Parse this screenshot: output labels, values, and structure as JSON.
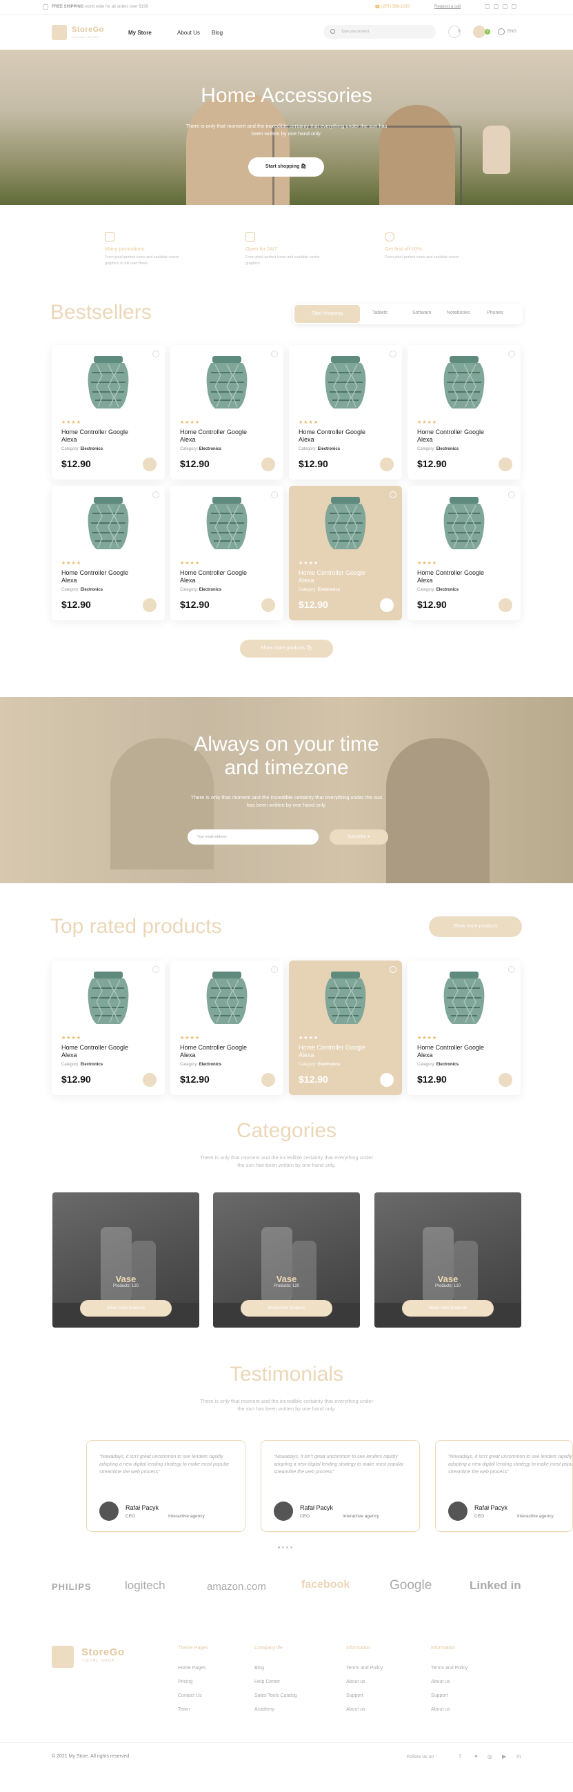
{
  "topbar": {
    "free_shipping_bold": "FREE SHIPPING",
    "free_shipping_text": "world wide for all orders over $199",
    "phone": "(207) 388-1220",
    "request_call": "Request a call"
  },
  "header": {
    "logo": {
      "name": "StoreGo",
      "tagline": "LOCAL SHOP"
    },
    "nav": [
      "My Store",
      "About Us",
      "Blog"
    ],
    "search_placeholder": "Type your product",
    "wishlist_count": "0",
    "cart_count": "0",
    "language": "ENG"
  },
  "hero": {
    "title": "Home Accessories",
    "text": "There is only that moment and the incredible certainty that everything under the sun has been written by one hand only.",
    "button": "Start shopping"
  },
  "features": [
    {
      "title": "Many promotions",
      "text": "From pixel-perfect icons and scalable vector graphics to full user flows"
    },
    {
      "title": "Open for 24/7",
      "text": "From pixel-perfect icons and scalable vector graphics"
    },
    {
      "title": "Get first off 10%",
      "text": "From pixel-perfect icons and scalable vector"
    }
  ],
  "bestsellers": {
    "title": "Bestsellers",
    "tabs": [
      "Start shopping",
      "Tablets",
      "Software",
      "Notebooks",
      "Phones"
    ],
    "show_more": "Show more products"
  },
  "product": {
    "stars": "★★★★",
    "name": "Home Controller Google Alexa",
    "category_label": "Category:",
    "category": "Electronics",
    "price": "$12.90"
  },
  "timezone": {
    "title_line1": "Always on your time",
    "title_line2": "and timezone",
    "text": "There is only that moment and the incredible certainty that everything under the sun has been written by one hand only.",
    "email_placeholder": "Your email address",
    "subscribe": "Subscribe"
  },
  "top_rated": {
    "title": "Top rated products",
    "show_more": "Show more products"
  },
  "categories": {
    "title": "Categories",
    "text": "There is only that moment and the incredible certainty that everything under the sun has been written by one hand only.",
    "items": [
      {
        "name": "Vase",
        "count": "Products: 120",
        "button": "Show more products"
      },
      {
        "name": "Vase",
        "count": "Products: 120",
        "button": "Show more products"
      },
      {
        "name": "Vase",
        "count": "Products: 120",
        "button": "Show more products"
      }
    ]
  },
  "testimonials": {
    "title": "Testimonials",
    "text": "There is only that moment and the incredible certainty that everything under the sun has been written by one hand only.",
    "items": [
      {
        "quote": "“Nowadays, it isn’t great uncommon to see lenders rapidly adopting a new digital lending strategy to make most popular streamline the web process”",
        "name": "Rafał Pacyk",
        "role": "CEO",
        "company": "Interactive agency"
      },
      {
        "quote": "“Nowadays, it isn’t great uncommon to see lenders rapidly adopting a new digital lending strategy to make most popular streamline the web process”",
        "name": "Rafał Pacyk",
        "role": "CEO",
        "company": "Interactive agency"
      },
      {
        "quote": "“Nowadays, it isn’t great uncommon to see lenders rapidly adopting a new digital lending strategy to make most popular streamline the web process”",
        "name": "Rafał Pacyk",
        "role": "CEO",
        "company": "Interactive agency"
      }
    ]
  },
  "brands": [
    "PHILIPS",
    "logitech",
    "amazon.com",
    "facebook",
    "Google",
    "Linked in"
  ],
  "footer": {
    "logo": {
      "name": "StoreGo",
      "tagline": "LOCAL SHOP"
    },
    "columns": [
      {
        "title": "Theme Pages",
        "links": [
          "Home Pages",
          "Pricing",
          "Contact Us",
          "Team"
        ]
      },
      {
        "title": "Company life",
        "links": [
          "Blog",
          "Help Center",
          "Sales Tools Catalog",
          "Academy"
        ]
      },
      {
        "title": "Information",
        "links": [
          "Terms and Policy",
          "About us",
          "Support",
          "About us"
        ]
      },
      {
        "title": "Information",
        "links": [
          "Terms and Policy",
          "About us",
          "Support",
          "About us"
        ]
      }
    ],
    "copyright": "© 2021 My Store. All rights reserved",
    "follow": "Follow us on :"
  }
}
